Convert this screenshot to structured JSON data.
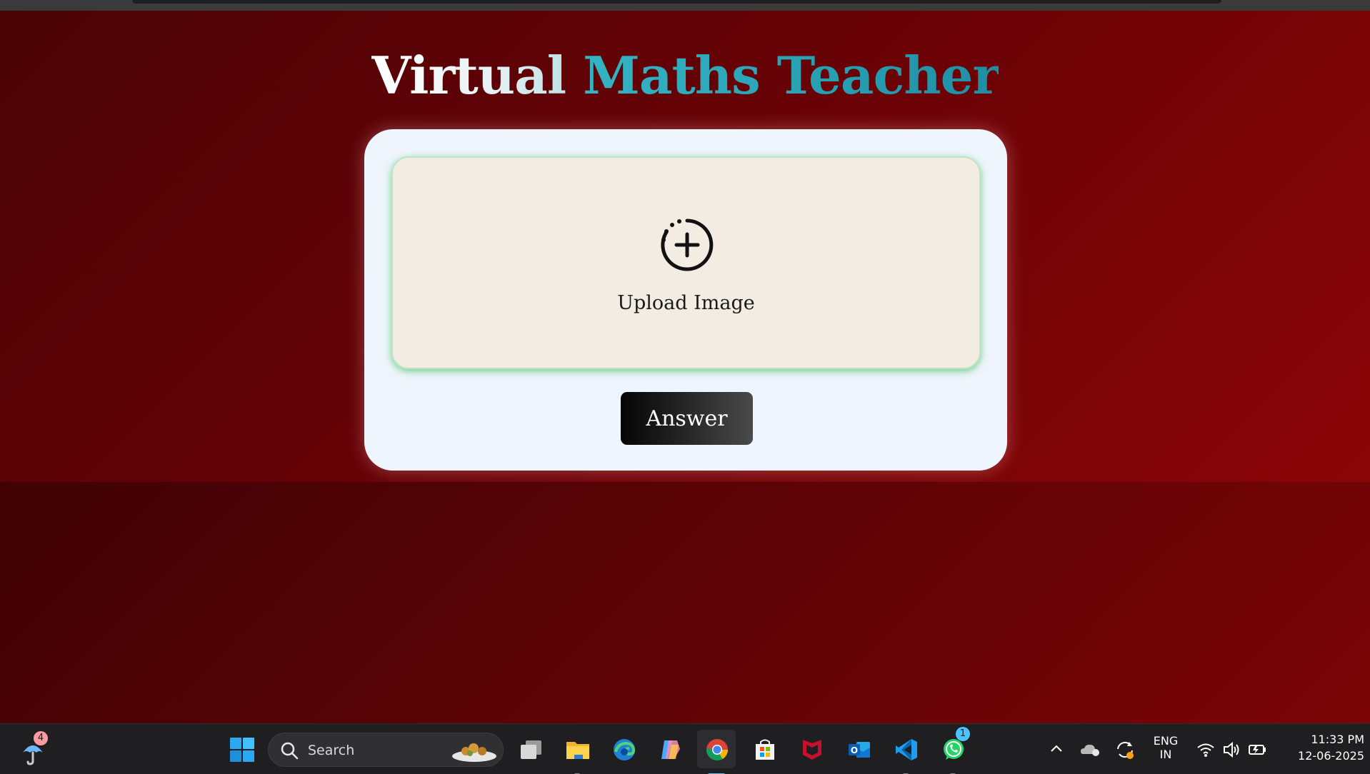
{
  "app": {
    "title_part1": "Virtual",
    "title_part2": "Maths Teacher",
    "upload_label": "Upload Image",
    "answer_label": "Answer"
  },
  "colors": {
    "background": "#6a0306",
    "card": "#eef5fc",
    "upload_area": "#f3ece2",
    "upload_glow": "#4cbe64",
    "title_accent": "#2aa3b5",
    "button": "#1a1a1a"
  },
  "taskbar": {
    "search_placeholder": "Search",
    "weather_badge": "4",
    "whatsapp_badge": "1",
    "language": "ENG",
    "region": "IN",
    "time": "11:33 PM",
    "date": "12-06-2025",
    "pinned_icons": [
      "task-view-icon",
      "file-explorer-icon",
      "edge-icon",
      "copilot-icon",
      "chrome-icon",
      "microsoft-store-icon",
      "mcafee-icon",
      "outlook-icon",
      "vscode-icon",
      "whatsapp-icon"
    ]
  }
}
